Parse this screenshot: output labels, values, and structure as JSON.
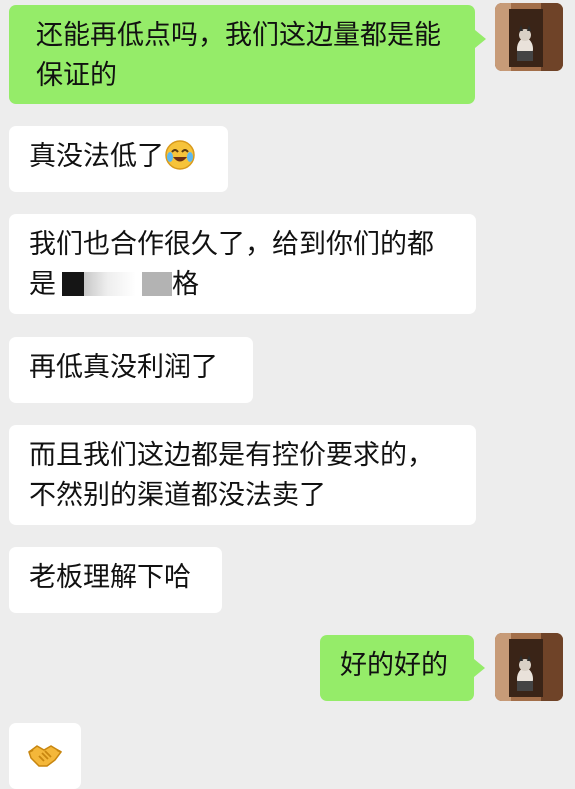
{
  "messages": [
    {
      "from": "me",
      "line1": "还能再低点吗，我们这边量都是能",
      "line2": "保证的"
    },
    {
      "from": "them",
      "text": "真没法低了",
      "emoji": "face-with-tears-of-joy"
    },
    {
      "from": "them",
      "line1": "我们也合作很久了，给到你们的都",
      "line2_start": "是",
      "line2_end": "格"
    },
    {
      "from": "them",
      "text": "再低真没利润了"
    },
    {
      "from": "them",
      "line1": "而且我们这边都是有控价要求的，",
      "line2": "不然别的渠道都没法卖了"
    },
    {
      "from": "them",
      "text": "老板理解下哈"
    },
    {
      "from": "me",
      "text": "好的好的"
    },
    {
      "from": "them",
      "emoji": "handshake"
    }
  ],
  "colors": {
    "background": "#ededed",
    "outgoing_bubble": "#95ec69",
    "incoming_bubble": "#ffffff"
  }
}
